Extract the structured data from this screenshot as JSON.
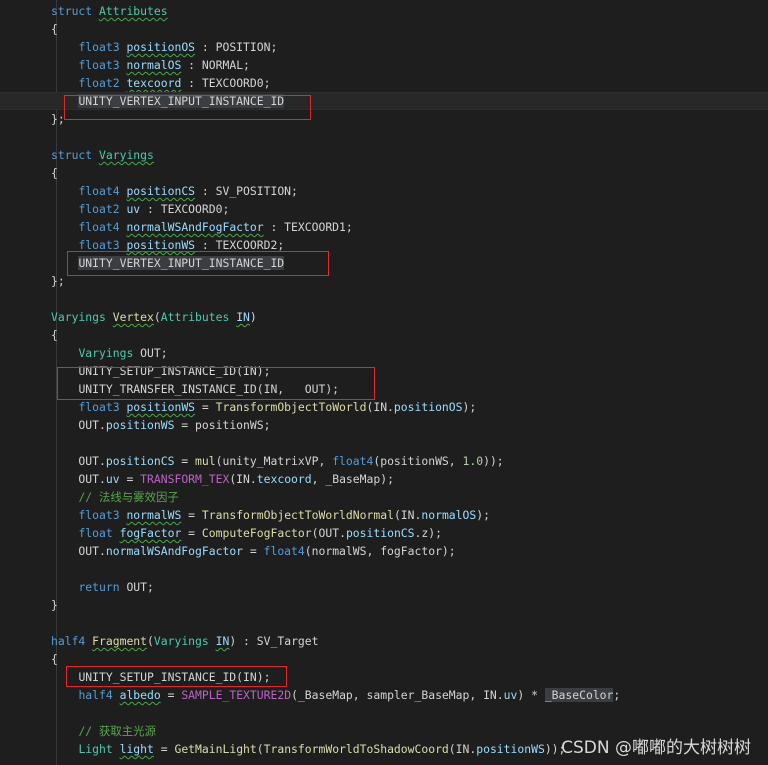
{
  "editor": {
    "lines": [
      {
        "tokens": [
          {
            "t": "struct ",
            "c": "kw"
          },
          {
            "t": "Attributes",
            "c": "type",
            "u": 1
          }
        ]
      },
      {
        "tokens": [
          {
            "t": "{",
            "c": "plain"
          }
        ]
      },
      {
        "tokens": [
          {
            "t": "    "
          },
          {
            "t": "float3",
            "c": "kw"
          },
          {
            "t": " "
          },
          {
            "t": "positionOS",
            "c": "var",
            "u": 1
          },
          {
            "t": " : POSITION;",
            "c": "plain"
          }
        ]
      },
      {
        "tokens": [
          {
            "t": "    "
          },
          {
            "t": "float3",
            "c": "kw"
          },
          {
            "t": " "
          },
          {
            "t": "normalOS",
            "c": "var",
            "u": 1
          },
          {
            "t": " : NORMAL;",
            "c": "plain"
          }
        ]
      },
      {
        "tokens": [
          {
            "t": "    "
          },
          {
            "t": "float2",
            "c": "kw"
          },
          {
            "t": " "
          },
          {
            "t": "texcoord",
            "c": "var",
            "u": 1
          },
          {
            "t": " : TEXCOORD0;",
            "c": "plain"
          }
        ]
      },
      {
        "current": true,
        "tokens": [
          {
            "t": "    "
          },
          {
            "t": "UNITY_VERTEX_INPUT_INSTANCE_ID",
            "c": "plain",
            "s": 1
          }
        ]
      },
      {
        "tokens": [
          {
            "t": "};",
            "c": "plain"
          }
        ]
      },
      {
        "tokens": []
      },
      {
        "tokens": [
          {
            "t": "struct ",
            "c": "kw"
          },
          {
            "t": "Varyings",
            "c": "type",
            "u": 1
          }
        ]
      },
      {
        "tokens": [
          {
            "t": "{",
            "c": "plain"
          }
        ]
      },
      {
        "tokens": [
          {
            "t": "    "
          },
          {
            "t": "float4",
            "c": "kw"
          },
          {
            "t": " "
          },
          {
            "t": "positionCS",
            "c": "var",
            "u": 1
          },
          {
            "t": " : SV_POSITION;",
            "c": "plain"
          }
        ]
      },
      {
        "tokens": [
          {
            "t": "    "
          },
          {
            "t": "float2",
            "c": "kw"
          },
          {
            "t": " "
          },
          {
            "t": "uv",
            "c": "var"
          },
          {
            "t": " : TEXCOORD0;",
            "c": "plain"
          }
        ]
      },
      {
        "tokens": [
          {
            "t": "    "
          },
          {
            "t": "float4",
            "c": "kw"
          },
          {
            "t": " "
          },
          {
            "t": "normalWSAndFogFactor",
            "c": "var",
            "u": 1
          },
          {
            "t": " : TEXCOORD1;",
            "c": "plain"
          }
        ]
      },
      {
        "tokens": [
          {
            "t": "    "
          },
          {
            "t": "float3",
            "c": "kw"
          },
          {
            "t": " "
          },
          {
            "t": "positionWS",
            "c": "var",
            "u": 1
          },
          {
            "t": " : TEXCOORD2;",
            "c": "plain"
          }
        ]
      },
      {
        "tokens": [
          {
            "t": "    "
          },
          {
            "t": "UNITY_VERTEX_INPUT_INSTANCE_ID",
            "c": "plain",
            "s": 1
          }
        ]
      },
      {
        "tokens": [
          {
            "t": "};",
            "c": "plain"
          }
        ]
      },
      {
        "tokens": []
      },
      {
        "tokens": [
          {
            "t": "Varyings",
            "c": "type"
          },
          {
            "t": " "
          },
          {
            "t": "Vertex",
            "c": "fn",
            "u": 1
          },
          {
            "t": "(",
            "c": "plain"
          },
          {
            "t": "Attributes",
            "c": "type"
          },
          {
            "t": " "
          },
          {
            "t": "IN",
            "c": "var",
            "u": 1
          },
          {
            "t": ")",
            "c": "plain"
          }
        ]
      },
      {
        "tokens": [
          {
            "t": "{",
            "c": "plain"
          }
        ]
      },
      {
        "tokens": [
          {
            "t": "    "
          },
          {
            "t": "Varyings",
            "c": "type"
          },
          {
            "t": " OUT;",
            "c": "plain"
          }
        ]
      },
      {
        "tokens": [
          {
            "t": "    "
          },
          {
            "t": "UNITY_SETUP_INSTANCE_ID(IN);",
            "c": "plain"
          }
        ]
      },
      {
        "tokens": [
          {
            "t": "    "
          },
          {
            "t": "UNITY_TRANSFER_INSTANCE_ID(IN,   OUT);",
            "c": "plain"
          }
        ]
      },
      {
        "tokens": [
          {
            "t": "    "
          },
          {
            "t": "float3",
            "c": "kw"
          },
          {
            "t": " "
          },
          {
            "t": "positionWS",
            "c": "var",
            "u": 1
          },
          {
            "t": " = ",
            "c": "plain"
          },
          {
            "t": "TransformObjectToWorld",
            "c": "fn"
          },
          {
            "t": "(IN.",
            "c": "plain"
          },
          {
            "t": "positionOS",
            "c": "var"
          },
          {
            "t": ");",
            "c": "plain"
          }
        ]
      },
      {
        "tokens": [
          {
            "t": "    OUT.",
            "c": "plain"
          },
          {
            "t": "positionWS",
            "c": "var"
          },
          {
            "t": " = positionWS;",
            "c": "plain"
          }
        ]
      },
      {
        "tokens": []
      },
      {
        "tokens": [
          {
            "t": "    OUT.",
            "c": "plain"
          },
          {
            "t": "positionCS",
            "c": "var"
          },
          {
            "t": " = ",
            "c": "plain"
          },
          {
            "t": "mul",
            "c": "fn"
          },
          {
            "t": "(unity_MatrixVP, ",
            "c": "plain"
          },
          {
            "t": "float4",
            "c": "kw"
          },
          {
            "t": "(positionWS, ",
            "c": "plain"
          },
          {
            "t": "1.0",
            "c": "num"
          },
          {
            "t": "));",
            "c": "plain"
          }
        ]
      },
      {
        "tokens": [
          {
            "t": "    OUT.",
            "c": "plain"
          },
          {
            "t": "uv",
            "c": "var"
          },
          {
            "t": " = ",
            "c": "plain"
          },
          {
            "t": "TRANSFORM_TEX",
            "c": "macro"
          },
          {
            "t": "(IN.",
            "c": "plain"
          },
          {
            "t": "texcoord",
            "c": "var"
          },
          {
            "t": ", _BaseMap);",
            "c": "plain"
          }
        ]
      },
      {
        "tokens": [
          {
            "t": "    "
          },
          {
            "t": "// 法线与雾效因子",
            "c": "cm"
          }
        ]
      },
      {
        "tokens": [
          {
            "t": "    "
          },
          {
            "t": "float3",
            "c": "kw"
          },
          {
            "t": " "
          },
          {
            "t": "normalWS",
            "c": "var",
            "u": 1
          },
          {
            "t": " = ",
            "c": "plain"
          },
          {
            "t": "TransformObjectToWorldNormal",
            "c": "fn"
          },
          {
            "t": "(IN.",
            "c": "plain"
          },
          {
            "t": "normalOS",
            "c": "var"
          },
          {
            "t": ");",
            "c": "plain"
          }
        ]
      },
      {
        "tokens": [
          {
            "t": "    "
          },
          {
            "t": "float",
            "c": "kw"
          },
          {
            "t": " "
          },
          {
            "t": "fogFactor",
            "c": "var",
            "u": 1
          },
          {
            "t": " = ",
            "c": "plain"
          },
          {
            "t": "ComputeFogFactor",
            "c": "fn"
          },
          {
            "t": "(OUT.",
            "c": "plain"
          },
          {
            "t": "positionCS",
            "c": "var"
          },
          {
            "t": ".z);",
            "c": "plain"
          }
        ]
      },
      {
        "tokens": [
          {
            "t": "    OUT.",
            "c": "plain"
          },
          {
            "t": "normalWSAndFogFactor",
            "c": "var"
          },
          {
            "t": " = ",
            "c": "plain"
          },
          {
            "t": "float4",
            "c": "kw"
          },
          {
            "t": "(normalWS, fogFactor);",
            "c": "plain"
          }
        ]
      },
      {
        "tokens": []
      },
      {
        "tokens": [
          {
            "t": "    "
          },
          {
            "t": "return",
            "c": "kw"
          },
          {
            "t": " OUT;",
            "c": "plain"
          }
        ]
      },
      {
        "tokens": [
          {
            "t": "}",
            "c": "plain"
          }
        ]
      },
      {
        "tokens": []
      },
      {
        "tokens": [
          {
            "t": "half4",
            "c": "kw"
          },
          {
            "t": " "
          },
          {
            "t": "Fragment",
            "c": "fn",
            "u": 1
          },
          {
            "t": "(",
            "c": "plain"
          },
          {
            "t": "Varyings",
            "c": "type"
          },
          {
            "t": " "
          },
          {
            "t": "IN",
            "c": "var",
            "u": 1
          },
          {
            "t": ") : SV_Target",
            "c": "plain"
          }
        ]
      },
      {
        "tokens": [
          {
            "t": "{",
            "c": "plain"
          }
        ]
      },
      {
        "tokens": [
          {
            "t": "    "
          },
          {
            "t": "UNITY_SETUP_INSTANCE_ID(IN);",
            "c": "plain"
          }
        ]
      },
      {
        "tokens": [
          {
            "t": "    "
          },
          {
            "t": "half4",
            "c": "kw"
          },
          {
            "t": " "
          },
          {
            "t": "albedo",
            "c": "var",
            "u": 1
          },
          {
            "t": " = ",
            "c": "plain"
          },
          {
            "t": "SAMPLE_TEXTURE2D",
            "c": "macro"
          },
          {
            "t": "(_BaseMap, sampler_BaseMap, IN.",
            "c": "plain"
          },
          {
            "t": "uv",
            "c": "var"
          },
          {
            "t": ") * ",
            "c": "plain"
          },
          {
            "t": "_BaseColor",
            "c": "plain",
            "s": 1
          },
          {
            "t": ";",
            "c": "plain"
          }
        ]
      },
      {
        "tokens": []
      },
      {
        "tokens": [
          {
            "t": "    "
          },
          {
            "t": "// 获取主光源",
            "c": "cm"
          }
        ]
      },
      {
        "tokens": [
          {
            "t": "    "
          },
          {
            "t": "Light",
            "c": "type"
          },
          {
            "t": " "
          },
          {
            "t": "light",
            "c": "var",
            "u": 1
          },
          {
            "t": " = ",
            "c": "plain"
          },
          {
            "t": "GetMainLight",
            "c": "fn"
          },
          {
            "t": "(",
            "c": "plain"
          },
          {
            "t": "TransformWorldToShadowCoord",
            "c": "fn"
          },
          {
            "t": "(IN.",
            "c": "plain"
          },
          {
            "t": "positionWS",
            "c": "var"
          },
          {
            "t": "));",
            "c": "plain"
          }
        ]
      }
    ]
  },
  "watermark": "CSDN @嘟嘟的大树树树"
}
